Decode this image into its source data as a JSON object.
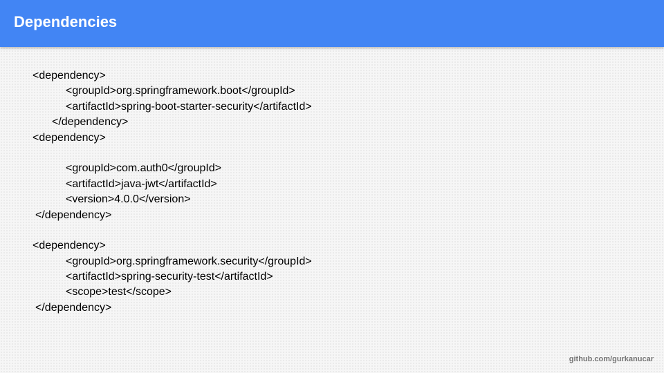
{
  "title": "Dependencies",
  "code_lines": [
    "<dependency>",
    "<groupId>org.springframework.boot</groupId>",
    "<artifactId>spring-boot-starter-security</artifactId>",
    "</dependency>",
    "<dependency>",
    "",
    "<groupId>com.auth0</groupId>",
    "<artifactId>java-jwt</artifactId>",
    "<version>4.0.0</version>",
    "</dependency>",
    "",
    "<dependency>",
    "<groupId>org.springframework.security</groupId>",
    "<artifactId>spring-security-test</artifactId>",
    "<scope>test</scope>",
    "</dependency>"
  ],
  "footer": "github.com/gurkanucar",
  "colors": {
    "header": "#4285f4",
    "title_text": "#ffffff",
    "footer_text": "#757575"
  }
}
